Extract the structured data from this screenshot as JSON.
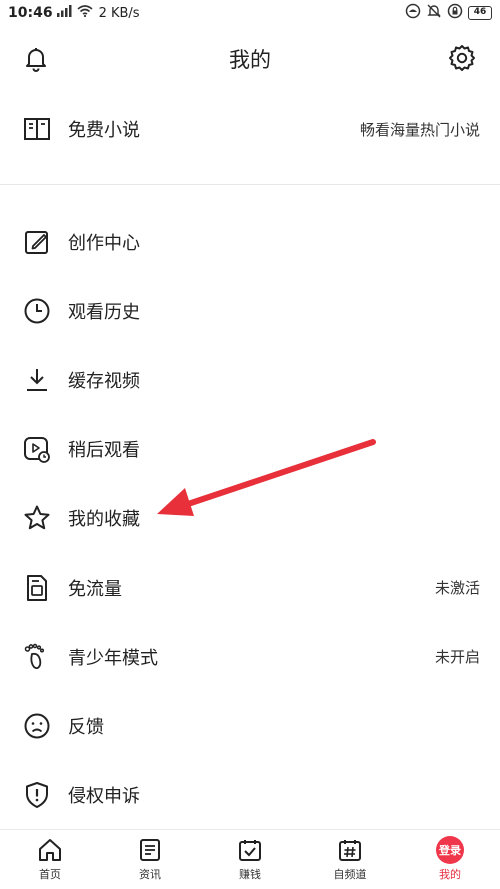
{
  "status_bar": {
    "time": "10:46",
    "network_rate": "2 KB/s",
    "battery": "46"
  },
  "header": {
    "title": "我的"
  },
  "promo": {
    "label": "免费小说",
    "note": "畅看海量热门小说",
    "icon": "book-icon"
  },
  "menu": [
    {
      "label": "创作中心",
      "note": "",
      "icon": "edit-icon"
    },
    {
      "label": "观看历史",
      "note": "",
      "icon": "clock-icon"
    },
    {
      "label": "缓存视频",
      "note": "",
      "icon": "download-icon"
    },
    {
      "label": "稍后观看",
      "note": "",
      "icon": "watch-later-icon"
    },
    {
      "label": "我的收藏",
      "note": "",
      "icon": "star-icon"
    },
    {
      "label": "免流量",
      "note": "未激活",
      "icon": "sim-card-icon"
    },
    {
      "label": "青少年模式",
      "note": "未开启",
      "icon": "footprint-icon"
    },
    {
      "label": "反馈",
      "note": "",
      "icon": "sad-face-icon"
    },
    {
      "label": "侵权申诉",
      "note": "",
      "icon": "shield-alert-icon"
    }
  ],
  "bottom_nav": [
    {
      "label": "首页",
      "icon": "home-icon"
    },
    {
      "label": "资讯",
      "icon": "news-icon"
    },
    {
      "label": "赚钱",
      "icon": "earn-icon"
    },
    {
      "label": "自频道",
      "icon": "channel-icon"
    },
    {
      "label": "我的",
      "icon": "me-icon",
      "badge": "登录"
    }
  ],
  "colors": {
    "accent": "#e5303f",
    "annotation_arrow": "#e8303a"
  }
}
